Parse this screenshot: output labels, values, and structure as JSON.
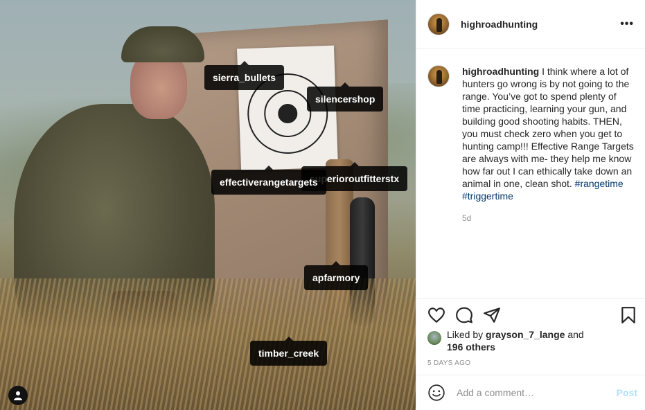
{
  "photo": {
    "tags": [
      {
        "id": "sierra",
        "label": "sierra_bullets"
      },
      {
        "id": "silencer",
        "label": "silencershop"
      },
      {
        "id": "superior",
        "label": "superioroutfitterstx"
      },
      {
        "id": "effective",
        "label": "effectiverangetargets"
      },
      {
        "id": "apf",
        "label": "apfarmory"
      },
      {
        "id": "timber",
        "label": "timber_creek"
      }
    ],
    "user_tags_icon": "person-icon"
  },
  "header": {
    "username": "highroadhunting",
    "more_icon": "more-options-icon",
    "more_glyph": "•••"
  },
  "caption": {
    "username": "highroadhunting",
    "text": " I think where a lot of hunters go wrong is by not going to the range. You’ve got to spend plenty of time practicing, learning your gun, and building good shooting habits. THEN, you must check zero when you get to hunting camp!!! Effective Range Targets are always with me- they help me know how far out I can ethically take down an animal in one, clean shot. ",
    "hashtag1": "#rangetime",
    "hashtag2": "#triggertime",
    "time": "5d"
  },
  "actions": {
    "icons": [
      "heart-icon",
      "comment-icon",
      "share-icon",
      "bookmark-icon"
    ]
  },
  "likes": {
    "prefix": "Liked by ",
    "user": "grayson_7_lange",
    "middle": " and",
    "others": "196 others"
  },
  "posted_ago": "5 DAYS AGO",
  "comment": {
    "placeholder": "Add a comment…",
    "post_label": "Post",
    "emoji_icon": "emoji-icon"
  },
  "colors": {
    "text": "#262626",
    "muted": "#8e8e8e",
    "hashtag": "#00376b",
    "post_disabled": "#b2dffc"
  }
}
